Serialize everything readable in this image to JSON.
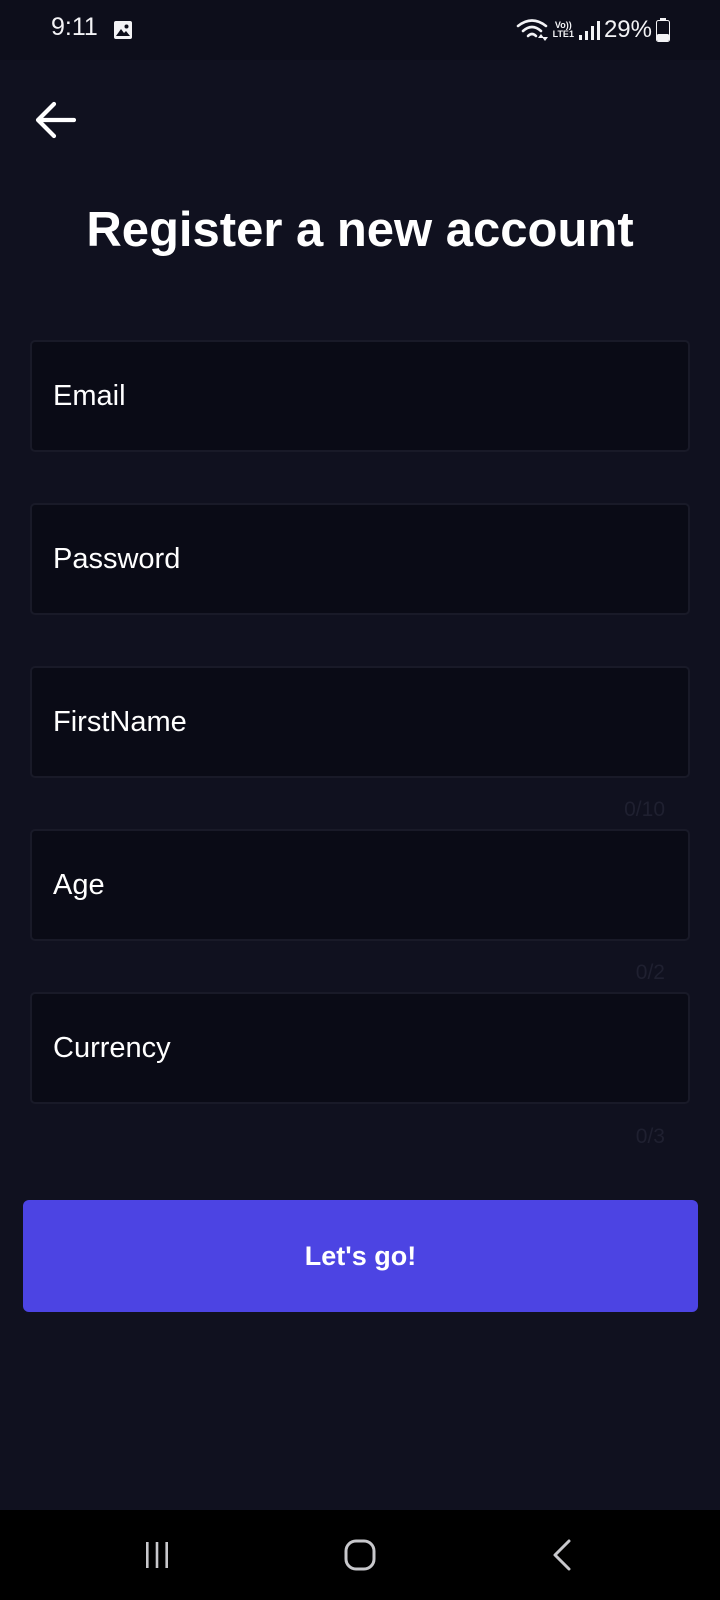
{
  "status_bar": {
    "time": "9:11",
    "volte_line1": "Vo))",
    "volte_line2": "LTE1",
    "battery": "29%"
  },
  "header": {
    "back_icon": "arrow-left-icon",
    "title": "Register a new account"
  },
  "form": {
    "fields": [
      {
        "placeholder": "Email",
        "value": ""
      },
      {
        "placeholder": "Password",
        "value": ""
      },
      {
        "placeholder": "FirstName",
        "value": "",
        "counter": "0/10"
      },
      {
        "placeholder": "Age",
        "value": "",
        "counter": "0/2"
      },
      {
        "placeholder": "Currency",
        "value": "",
        "counter": "0/3"
      }
    ],
    "submit_label": "Let's go!"
  },
  "nav_bar": {
    "recents_icon": "recent-apps-icon",
    "home_icon": "home-icon",
    "back_icon": "nav-back-icon"
  },
  "colors": {
    "background": "#10111f",
    "field_background": "#0a0b16",
    "accent": "#4c44e3",
    "counter_text": "#1f2030"
  }
}
